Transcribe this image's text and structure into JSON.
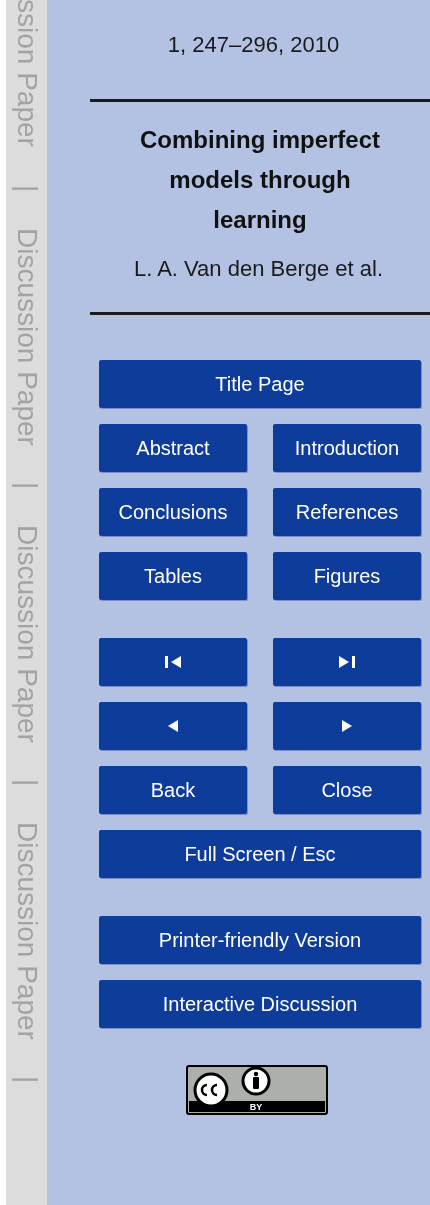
{
  "margin_strip": [
    "ssion Paper",
    "|",
    "Discussion Paper",
    "|",
    "Discussion Paper",
    "|",
    "Discussion Paper",
    "|"
  ],
  "citation": "1, 247–296, 2010",
  "title": "Combining imperfect models through learning",
  "authors": "L. A. Van den Berge et al.",
  "button_groups": [
    [
      {
        "kind": "wide",
        "label": "Title Page"
      },
      {
        "kind": "half",
        "label": "Abstract"
      },
      {
        "kind": "half",
        "label": "Introduction"
      },
      {
        "kind": "half",
        "label": "Conclusions"
      },
      {
        "kind": "half",
        "label": "References"
      },
      {
        "kind": "half",
        "label": "Tables"
      },
      {
        "kind": "half",
        "label": "Figures"
      }
    ],
    [
      {
        "kind": "first"
      },
      {
        "kind": "last"
      },
      {
        "kind": "previous"
      },
      {
        "kind": "next"
      },
      {
        "kind": "half",
        "label": "Back"
      },
      {
        "kind": "half",
        "label": "Close"
      },
      {
        "kind": "wide",
        "label": "Full Screen / Esc"
      }
    ],
    [
      {
        "kind": "wide",
        "label": "Printer-friendly Version"
      },
      {
        "kind": "wide",
        "label": "Interactive Discussion"
      }
    ]
  ],
  "license": {
    "label": "BY"
  }
}
